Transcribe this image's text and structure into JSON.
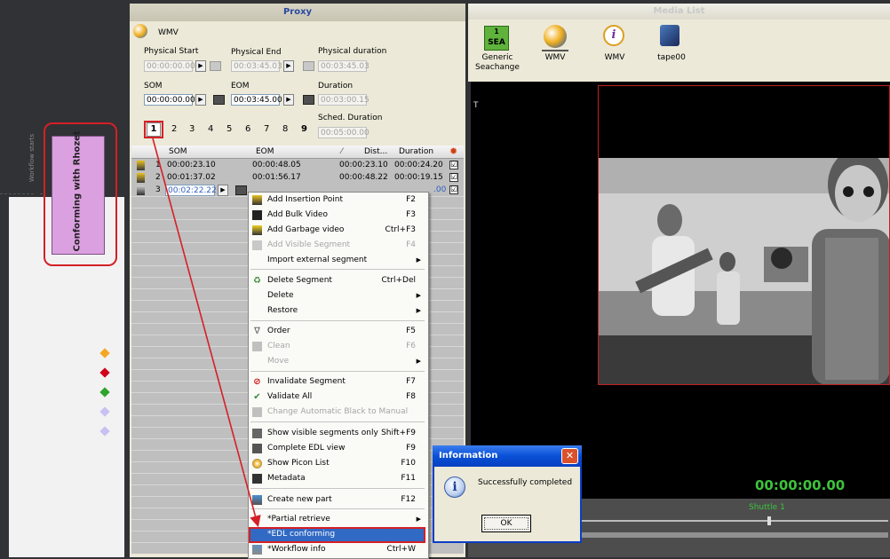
{
  "workflow": {
    "side_label": "Workflow starts",
    "node_label": "Conforming with Rhozet"
  },
  "proxy": {
    "title": "Proxy",
    "format": "WMV",
    "physical_start_label": "Physical Start",
    "physical_start": "00:00:00.00",
    "physical_end_label": "Physical End",
    "physical_end": "00:03:45.03",
    "physical_duration_label": "Physical duration",
    "physical_duration": "00:03:45.03",
    "som_label": "SOM",
    "som": "00:00:00.00",
    "eom_label": "EOM",
    "eom": "00:03:45.00",
    "duration_label": "Duration",
    "duration": "00:03:00.15",
    "sched_duration_label": "Sched. Duration",
    "sched_duration": "00:05:00.00",
    "pages": [
      "1",
      "2",
      "3",
      "4",
      "5",
      "6",
      "7",
      "8",
      "9"
    ],
    "table": {
      "columns": [
        "SOM",
        "EOM",
        "Dist...",
        "Duration"
      ],
      "rows": [
        {
          "num": "1",
          "som": "00:00:23.10",
          "eom": "00:00:48.05",
          "dist": "00:00:23.10",
          "duration": "00:00:24.20",
          "checked": "☑"
        },
        {
          "num": "2",
          "som": "00:01:37.02",
          "eom": "00:01:56.17",
          "dist": "00:00:48.22",
          "duration": "00:00:19.15",
          "checked": "☑"
        },
        {
          "num": "3",
          "som": "00:02:22.22",
          "eom": "",
          "dist": "",
          "duration": ".00",
          "checked": "☑"
        }
      ]
    }
  },
  "context_menu": {
    "items": [
      {
        "label": "Add Insertion Point",
        "shortcut": "F2"
      },
      {
        "label": "Add Bulk Video",
        "shortcut": "F3"
      },
      {
        "label": "Add Garbage video",
        "shortcut": "Ctrl+F3"
      },
      {
        "label": "Add Visible Segment",
        "shortcut": "F4"
      },
      {
        "label": "Import external segment",
        "shortcut": ""
      },
      {
        "label": "Delete Segment",
        "shortcut": "Ctrl+Del"
      },
      {
        "label": "Delete",
        "shortcut": ""
      },
      {
        "label": "Restore",
        "shortcut": ""
      },
      {
        "label": "Order",
        "shortcut": "F5"
      },
      {
        "label": "Clean",
        "shortcut": "F6"
      },
      {
        "label": "Move",
        "shortcut": ""
      },
      {
        "label": "Invalidate Segment",
        "shortcut": "F7"
      },
      {
        "label": "Validate All",
        "shortcut": "F8"
      },
      {
        "label": "Change Automatic Black to Manual",
        "shortcut": ""
      },
      {
        "label": "Show visible segments only",
        "shortcut": "Shift+F9"
      },
      {
        "label": "Complete EDL view",
        "shortcut": "F9"
      },
      {
        "label": "Show Picon List",
        "shortcut": "F10"
      },
      {
        "label": "Metadata",
        "shortcut": "F11"
      },
      {
        "label": "Create new part",
        "shortcut": "F12"
      },
      {
        "label": "*Partial retrieve",
        "shortcut": ""
      },
      {
        "label": "*EDL conforming",
        "shortcut": ""
      },
      {
        "label": "*Workflow info",
        "shortcut": "Ctrl+W"
      }
    ]
  },
  "media_list": {
    "title": "Media List",
    "marker": "T",
    "items": [
      {
        "label": "Generic Seachange",
        "badge_top": "1",
        "badge_bottom": "SEA"
      },
      {
        "label": "WMV"
      },
      {
        "label": "WMV"
      },
      {
        "label": "tape00"
      }
    ]
  },
  "player": {
    "timecode": "00:00:00.00",
    "shuttle_label": "Shuttle 1"
  },
  "dialog": {
    "title": "Information",
    "message": "Successfully completed",
    "ok_label": "OK",
    "close_glyph": "✕",
    "icon_glyph": "i"
  },
  "colors": {
    "highlight": "#d42027",
    "selection": "#316ac5",
    "timecode": "#3cc43c"
  }
}
